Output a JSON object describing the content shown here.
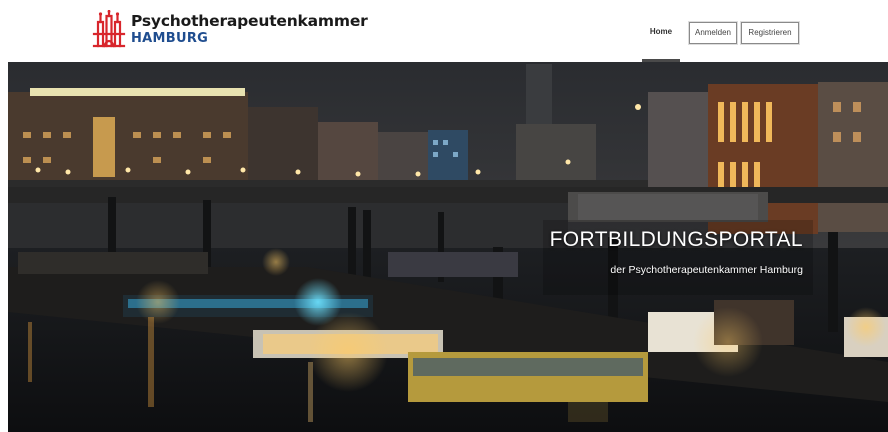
{
  "brand": {
    "name_line1": "Psychotherapeutenkammer",
    "name_line2": "HAMBURG",
    "logo_icon": "hamburg-castle-logo",
    "color_red": "#d8262c",
    "color_blue": "#1f4d8f"
  },
  "nav": {
    "home_label": "Home",
    "login_label": "Anmelden",
    "register_label": "Registrieren"
  },
  "hero": {
    "title": "FORTBILDUNGSPORTAL",
    "subtitle": "der Psychotherapeutenkammer Hamburg",
    "image_subject": "Hamburg harbour at night with houseboats and city lights"
  }
}
